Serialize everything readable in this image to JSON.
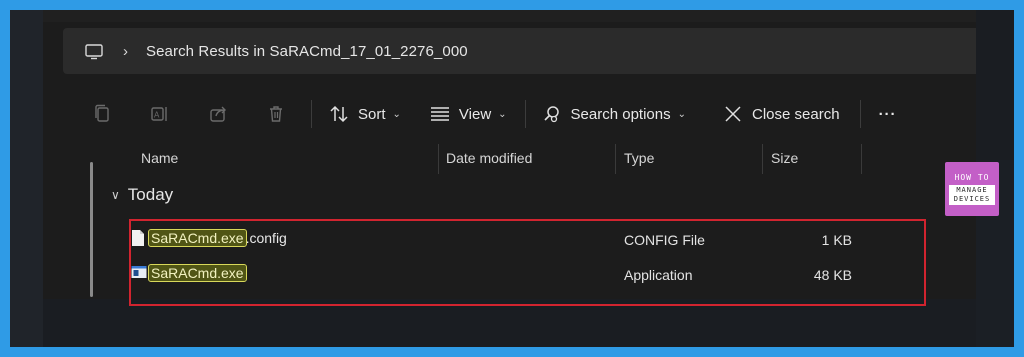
{
  "address": {
    "location_icon": "computer-icon",
    "breadcrumb": "Search Results in SaRACmd_17_01_2276_000"
  },
  "toolbar": {
    "sort_label": "Sort",
    "view_label": "View",
    "search_options_label": "Search options",
    "close_search_label": "Close search",
    "more_label": "···",
    "icons": [
      "copy-icon",
      "rename-icon",
      "share-icon",
      "delete-icon",
      "sort-icon",
      "view-icon",
      "search-options-icon",
      "close-icon"
    ]
  },
  "columns": {
    "name": "Name",
    "date_modified": "Date modified",
    "type": "Type",
    "size": "Size"
  },
  "group": {
    "label": "Today"
  },
  "files": [
    {
      "name_highlight": "SaRACmd.exe",
      "name_rest": ".config",
      "type": "CONFIG File",
      "size": "1 KB",
      "icon": "document-icon"
    },
    {
      "name_highlight": "SaRACmd.exe",
      "name_rest": "",
      "type": "Application",
      "size": "48 KB",
      "icon": "application-icon"
    }
  ],
  "brand": {
    "line1": "HOW TO",
    "line2": "MANAGE DEVICES"
  },
  "colors": {
    "frame": "#2f9be6",
    "highlight_box": "#d1242f",
    "search_highlight": "#d8d85a"
  }
}
